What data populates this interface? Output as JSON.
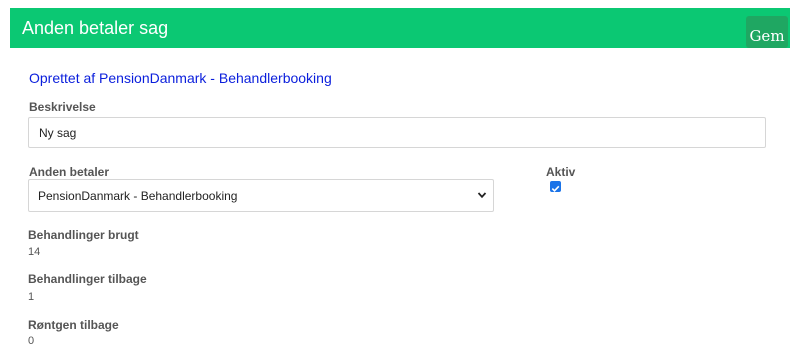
{
  "header": {
    "title": "Anden betaler sag",
    "save_label": "Gem"
  },
  "created_by": "Oprettet af PensionDanmark - Behandlerbooking",
  "description": {
    "label": "Beskrivelse",
    "value": "Ny sag"
  },
  "payer": {
    "label": "Anden betaler",
    "selected": "PensionDanmark - Behandlerbooking"
  },
  "active": {
    "label": "Aktiv",
    "checked": true
  },
  "stats": {
    "treatments_used_label": "Behandlinger brugt",
    "treatments_used_value": "14",
    "treatments_left_label": "Behandlinger tilbage",
    "treatments_left_value": "1",
    "xray_left_label": "Røntgen tilbage",
    "xray_left_value": "0"
  },
  "colors": {
    "header_bg": "#0bc873",
    "save_button_bg": "#1fa762",
    "link_blue": "#0a1edc",
    "checkbox_blue": "#1a73e8"
  },
  "icons": {
    "select_arrow": "chevron-down-icon",
    "checkbox_mark": "checkmark-icon"
  }
}
